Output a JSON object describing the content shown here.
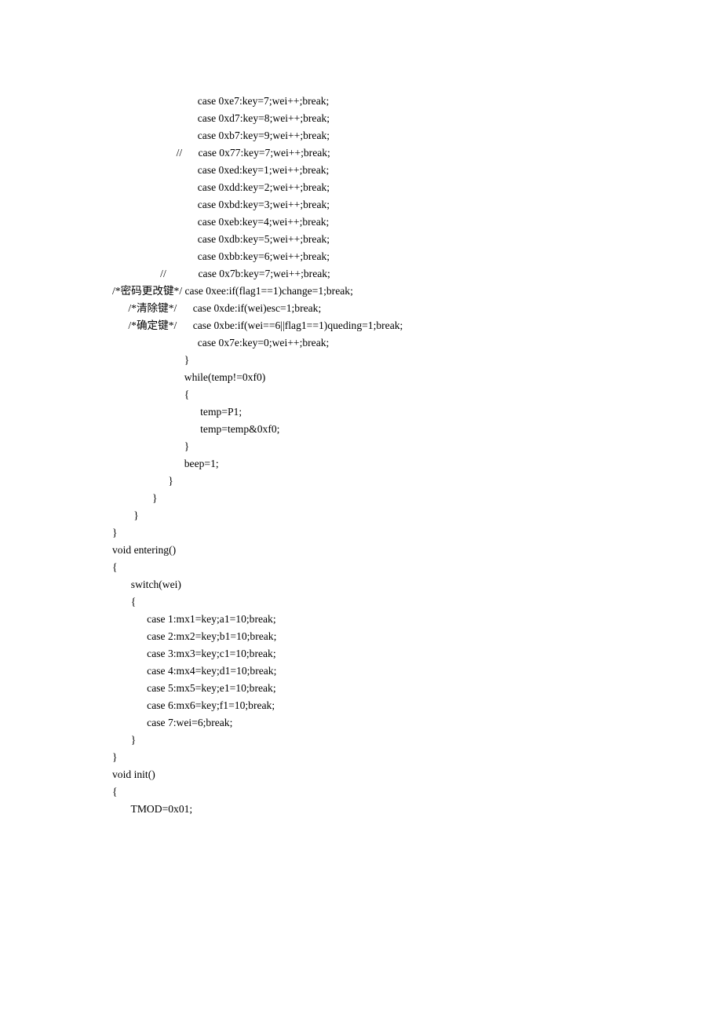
{
  "lines": [
    "                                case 0xe7:key=7;wei++;break;",
    "                                case 0xd7:key=8;wei++;break;",
    "                                case 0xb7:key=9;wei++;break;",
    "                        //      case 0x77:key=7;wei++;break;",
    "                                case 0xed:key=1;wei++;break;",
    "                                case 0xdd:key=2;wei++;break;",
    "                                case 0xbd:key=3;wei++;break;",
    "                                case 0xeb:key=4;wei++;break;",
    "                                case 0xdb:key=5;wei++;break;",
    "                                case 0xbb:key=6;wei++;break;",
    "                  //            case 0x7b:key=7;wei++;break;",
    "/*密码更改键*/ case 0xee:if(flag1==1)change=1;break;",
    "      /*清除键*/      case 0xde:if(wei)esc=1;break;",
    "      /*确定键*/      case 0xbe:if(wei==6||flag1==1)queding=1;break;",
    "                                case 0x7e:key=0;wei++;break;",
    "",
    "",
    "                           }",
    "                           while(temp!=0xf0)",
    "                           {",
    "                                 temp=P1;",
    "                                 temp=temp&0xf0;",
    "                           }",
    "                           beep=1;",
    "                     }",
    "               }",
    "        }",
    "}",
    "void entering()",
    "{",
    "       switch(wei)",
    "       {",
    "             case 1:mx1=key;a1=10;break;",
    "             case 2:mx2=key;b1=10;break;",
    "             case 3:mx3=key;c1=10;break;",
    "             case 4:mx4=key;d1=10;break;",
    "             case 5:mx5=key;e1=10;break;",
    "             case 6:mx6=key;f1=10;break;",
    "             case 7:wei=6;break;",
    "       }",
    "}",
    "void init()",
    "{",
    "       TMOD=0x01;"
  ]
}
